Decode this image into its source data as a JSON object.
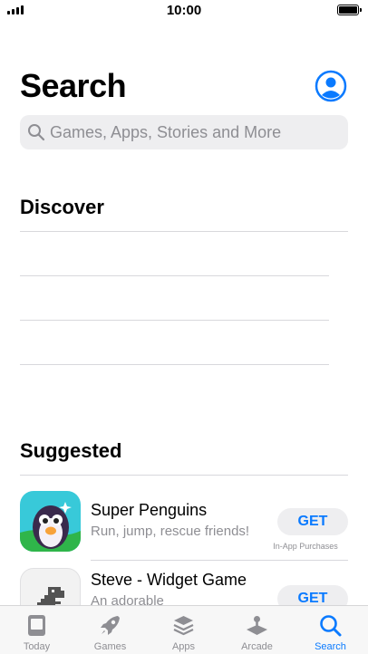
{
  "status_bar": {
    "time": "10:00"
  },
  "header": {
    "title": "Search"
  },
  "search": {
    "placeholder": "Games, Apps, Stories and More"
  },
  "discover": {
    "title": "Discover",
    "items": [
      "",
      "",
      ""
    ]
  },
  "suggested": {
    "title": "Suggested",
    "apps": [
      {
        "name": "Super Penguins",
        "subtitle": "Run, jump, rescue friends!",
        "action": "GET",
        "note": "In-App Purchases",
        "icon": "penguin-app-icon"
      },
      {
        "name": "Steve - Widget Game",
        "subtitle": "An adorable",
        "action": "GET",
        "note": "",
        "icon": "dinosaur-app-icon"
      }
    ]
  },
  "tab_bar": {
    "tabs": [
      {
        "label": "Today",
        "icon": "today-icon",
        "active": false
      },
      {
        "label": "Games",
        "icon": "rocket-icon",
        "active": false
      },
      {
        "label": "Apps",
        "icon": "layers-icon",
        "active": false
      },
      {
        "label": "Arcade",
        "icon": "joystick-icon",
        "active": false
      },
      {
        "label": "Search",
        "icon": "search-icon",
        "active": true
      }
    ]
  },
  "colors": {
    "accent": "#0a7aff",
    "inactive": "#8e8e93",
    "field_bg": "#eeeef0"
  }
}
